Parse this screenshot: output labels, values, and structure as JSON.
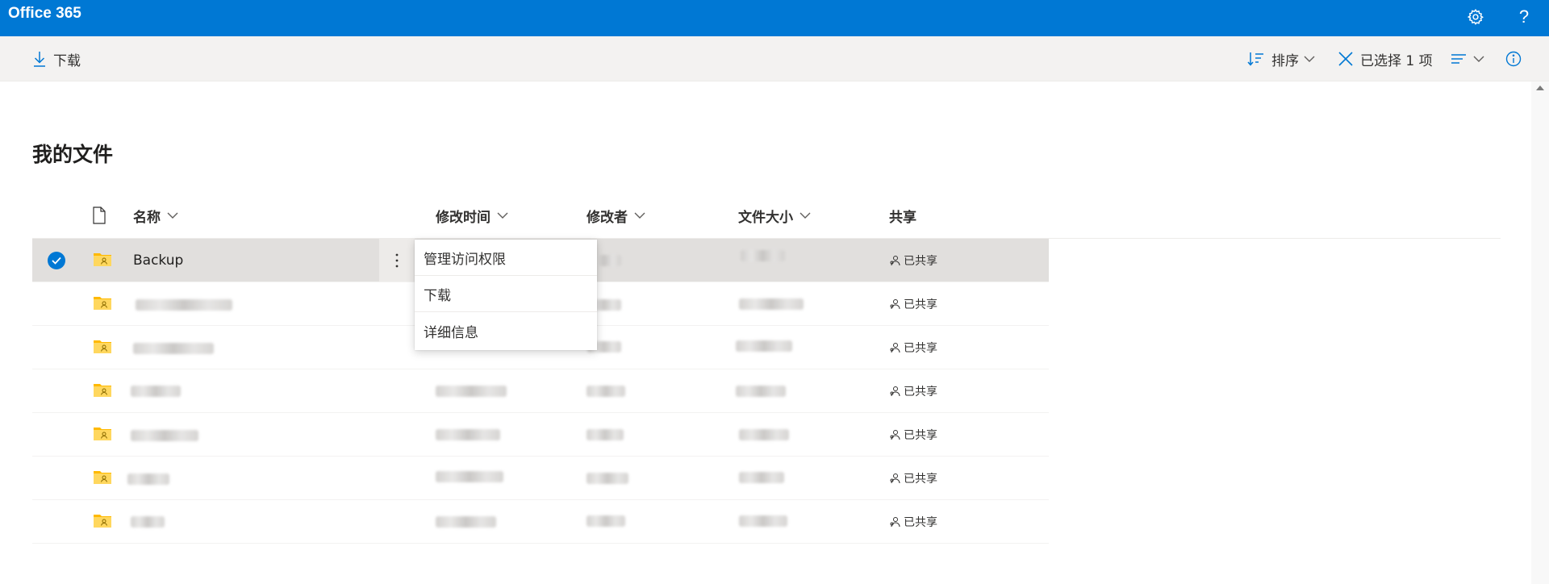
{
  "suite_bar": {
    "brand": "Office 365",
    "help_glyph": "?",
    "icons": [
      "gear-icon",
      "help-icon"
    ],
    "background": "#0078d4"
  },
  "command_bar": {
    "download_label": "下载",
    "sort_label": "排序",
    "selected_label": "已选择 1 项",
    "icons": [
      "download-icon",
      "sort-icon",
      "close-icon",
      "view-options-icon",
      "info-icon"
    ]
  },
  "page": {
    "title": "我的文件"
  },
  "table": {
    "columns": {
      "name": "名称",
      "modified": "修改时间",
      "modified_by": "修改者",
      "size": "文件大小",
      "sharing": "共享"
    },
    "rows": [
      {
        "name": "Backup",
        "sharing": "已共享",
        "selected": true
      },
      {
        "name": "",
        "sharing": "已共享",
        "selected": false
      },
      {
        "name": "",
        "sharing": "已共享",
        "selected": false
      },
      {
        "name": "",
        "sharing": "已共享",
        "selected": false
      },
      {
        "name": "",
        "sharing": "已共享",
        "selected": false
      },
      {
        "name": "",
        "sharing": "已共享",
        "selected": false
      },
      {
        "name": "",
        "sharing": "已共享",
        "selected": false
      }
    ]
  },
  "context_menu": {
    "items": [
      {
        "label": "管理访问权限"
      },
      {
        "label": "下载"
      },
      {
        "label": "详细信息"
      }
    ]
  },
  "colors": {
    "accent": "#0078d4",
    "folder": "#ffb900",
    "selected_row": "#e1dfdd"
  }
}
